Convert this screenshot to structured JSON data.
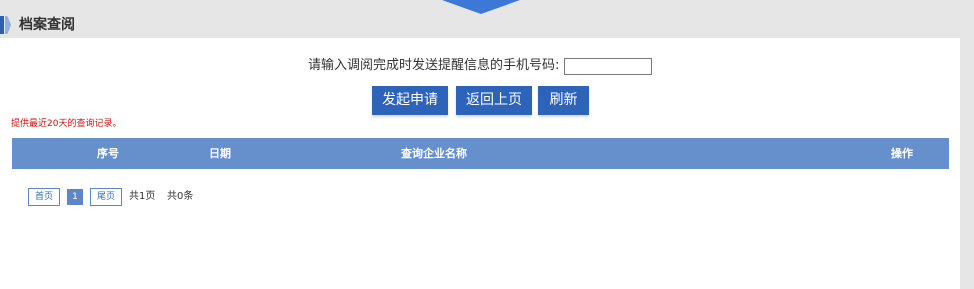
{
  "header": {
    "title": "档案查阅"
  },
  "form": {
    "phone_label": "请输入调阅完成时发送提醒信息的手机号码:",
    "phone_value": ""
  },
  "buttons": {
    "apply": "发起申请",
    "back": "返回上页",
    "refresh": "刷新"
  },
  "notice": "提供最近20天的查询记录。",
  "table": {
    "columns": [
      "序号",
      "日期",
      "查询企业名称",
      "操作"
    ],
    "rows": []
  },
  "pager": {
    "first": "首页",
    "current": "1",
    "last": "尾页",
    "total_pages": "共1页",
    "total_records": "共0条"
  },
  "colors": {
    "accent": "#2d63b9",
    "table_header": "#6690cc",
    "notice": "#cc1111"
  }
}
